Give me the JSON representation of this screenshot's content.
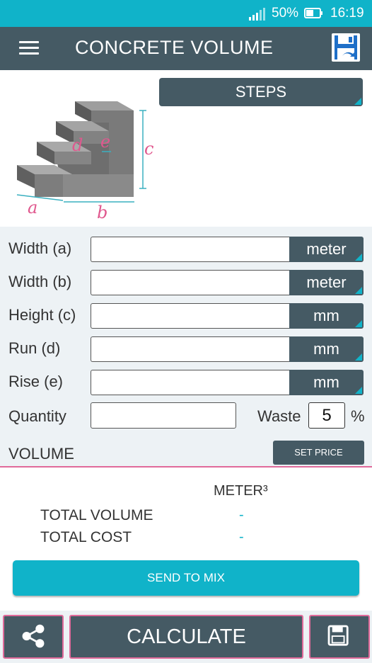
{
  "status_bar": {
    "battery_percent": "50%",
    "time": "16:19"
  },
  "toolbar": {
    "title": "CONCRETE VOLUME"
  },
  "diagram": {
    "labels": [
      "a",
      "b",
      "c",
      "d",
      "e"
    ]
  },
  "shape_selector": {
    "label": "STEPS"
  },
  "form": {
    "rows": [
      {
        "label": "Width (a)",
        "value": "",
        "unit": "meter"
      },
      {
        "label": "Width (b)",
        "value": "",
        "unit": "meter"
      },
      {
        "label": "Height (c)",
        "value": "",
        "unit": "mm"
      },
      {
        "label": "Run (d)",
        "value": "",
        "unit": "mm"
      },
      {
        "label": "Rise (e)",
        "value": "",
        "unit": "mm"
      }
    ],
    "quantity": {
      "label": "Quantity",
      "value": ""
    },
    "waste": {
      "label": "Waste",
      "value": "5",
      "suffix": "%"
    }
  },
  "volume": {
    "title": "VOLUME",
    "set_price_label": "SET PRICE",
    "unit_header": "METER³",
    "total_volume": {
      "label": "TOTAL VOLUME",
      "value": "-"
    },
    "total_cost": {
      "label": "TOTAL COST",
      "value": "-"
    }
  },
  "send_to_mix_label": "SEND TO MIX",
  "bottom_bar": {
    "calculate_label": "CALCULATE"
  },
  "colors": {
    "primary": "#455a64",
    "accent": "#10b3c9",
    "highlight": "#e06a9a"
  }
}
